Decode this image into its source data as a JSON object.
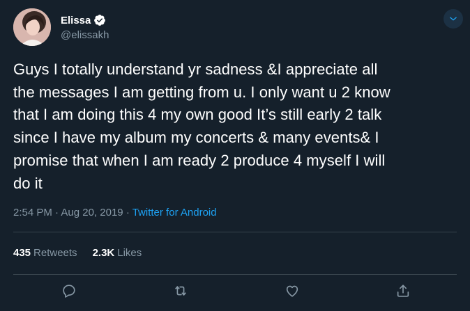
{
  "author": {
    "display_name": "Elissa",
    "handle": "@elissakh",
    "verified": true
  },
  "tweet": {
    "text": "Guys I totally understand yr sadness &I appreciate all\nthe messages I am getting from u. I only want u 2 know\nthat I am doing this 4 my own good It’s still early 2 talk\nsince I have my album my concerts & many events& I\npromise that when I am ready 2 produce 4 myself I will\ndo it",
    "time": "2:54 PM",
    "separator": "·",
    "date": "Aug 20, 2019",
    "source": "Twitter for Android"
  },
  "stats": {
    "retweets_count": "435",
    "retweets_label": "Retweets",
    "likes_count": "2.3K",
    "likes_label": "Likes"
  },
  "actions": {
    "reply_icon": "reply-icon",
    "retweet_icon": "retweet-icon",
    "like_icon": "like-icon",
    "share_icon": "share-icon"
  },
  "colors": {
    "background": "#15202b",
    "text_primary": "#ffffff",
    "text_secondary": "#8899a6",
    "accent": "#1da1f2",
    "divider": "#38444d"
  }
}
